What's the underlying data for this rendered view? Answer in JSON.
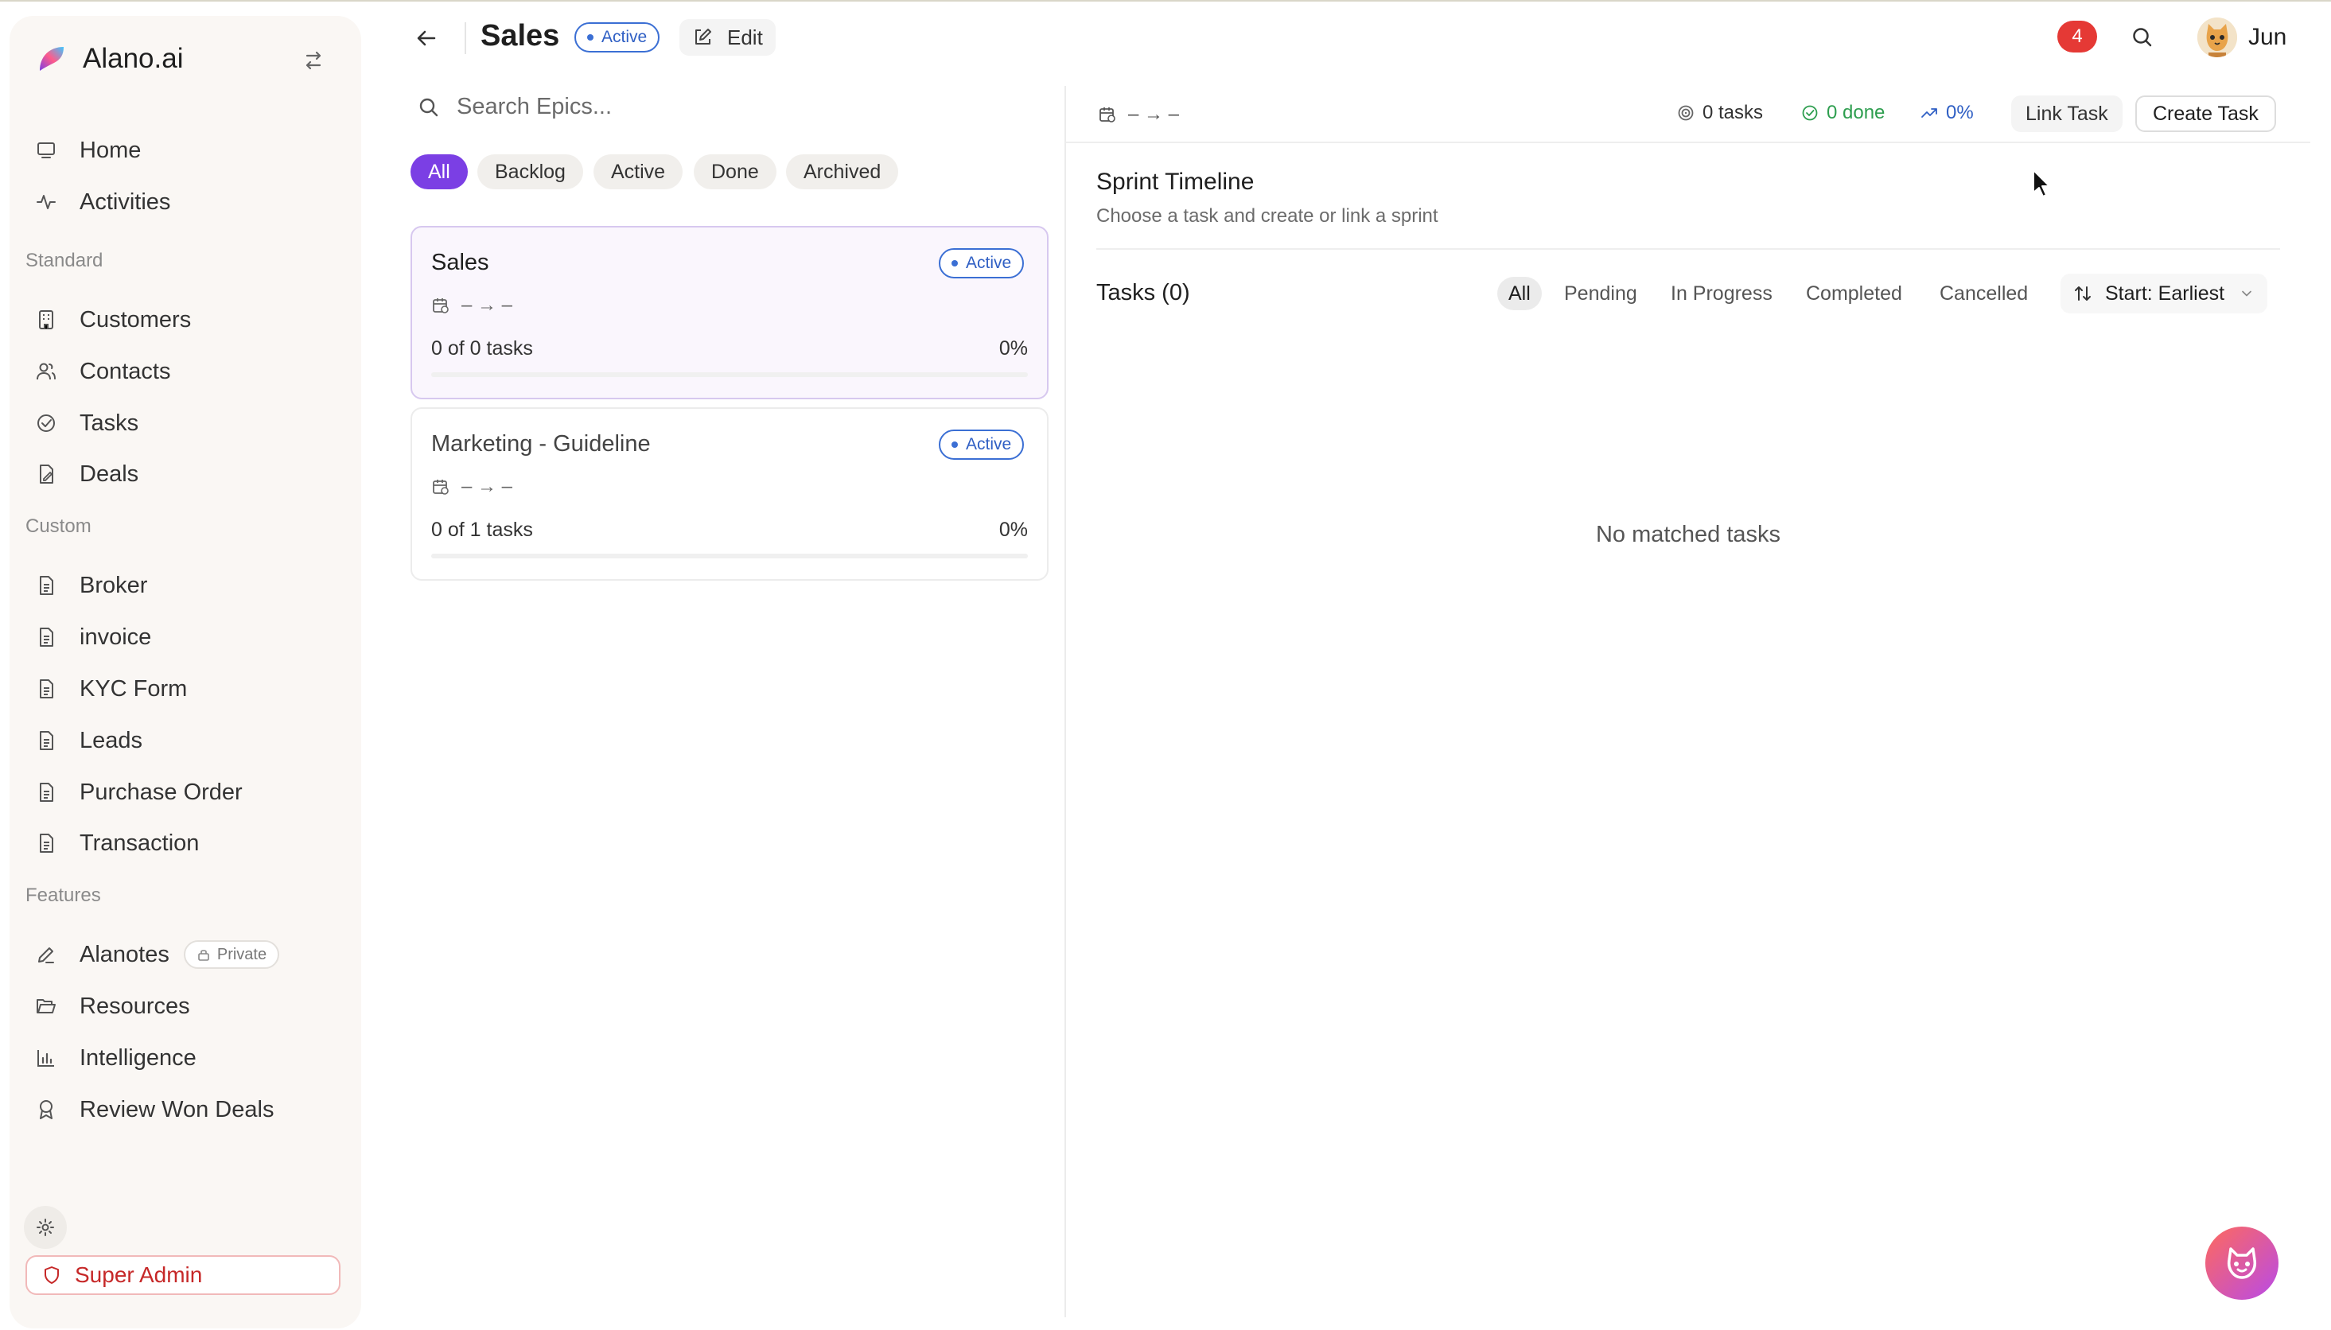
{
  "app": {
    "name": "Alano.ai"
  },
  "sidebar": {
    "main_items": [
      {
        "label": "Home",
        "icon": "monitor-icon"
      },
      {
        "label": "Activities",
        "icon": "activity-icon"
      }
    ],
    "standard_title": "Standard",
    "standard_items": [
      {
        "label": "Customers"
      },
      {
        "label": "Contacts"
      },
      {
        "label": "Tasks"
      },
      {
        "label": "Deals"
      }
    ],
    "custom_title": "Custom",
    "custom_items": [
      {
        "label": "Broker"
      },
      {
        "label": "invoice"
      },
      {
        "label": "KYC Form"
      },
      {
        "label": "Leads"
      },
      {
        "label": "Purchase Order"
      },
      {
        "label": "Transaction"
      }
    ],
    "features_title": "Features",
    "features_items": [
      {
        "label": "Alanotes",
        "badge": "Private"
      },
      {
        "label": "Resources"
      },
      {
        "label": "Intelligence"
      },
      {
        "label": "Review Won Deals"
      }
    ],
    "super_admin_label": "Super Admin"
  },
  "header": {
    "title": "Sales",
    "status": "Active",
    "edit_label": "Edit",
    "notification_count": "4",
    "user_name": "Jun"
  },
  "epics": {
    "search_placeholder": "Search Epics...",
    "filters": [
      "All",
      "Backlog",
      "Active",
      "Done",
      "Archived"
    ],
    "active_filter": "All",
    "items": [
      {
        "name": "Sales",
        "status": "Active",
        "range": "– → –",
        "tasks": "0 of 0 tasks",
        "percent": "0%",
        "progress": 0
      },
      {
        "name": "Marketing - Guideline",
        "status": "Active",
        "range": "– → –",
        "tasks": "0 of 1 tasks",
        "percent": "0%",
        "progress": 0
      }
    ]
  },
  "detail": {
    "range": "– → –",
    "stats": {
      "tasks": "0 tasks",
      "done": "0 done",
      "progress": "0%"
    },
    "link_task_label": "Link Task",
    "create_task_label": "Create Task",
    "timeline_title": "Sprint Timeline",
    "timeline_subtitle": "Choose a task and create or link a sprint",
    "tasks_title": "Tasks (0)",
    "task_filters": [
      "All",
      "Pending",
      "In Progress",
      "Completed",
      "Cancelled"
    ],
    "active_task_filter": "All",
    "sort_label": "Start: Earliest",
    "empty_message": "No matched tasks"
  },
  "colors": {
    "accent": "#7b3fe4",
    "status_blue": "#3b6fd4",
    "done_green": "#2e9e4f",
    "progress_blue": "#2f5fc4",
    "notification_red": "#e53935",
    "admin_red": "#c62828"
  }
}
